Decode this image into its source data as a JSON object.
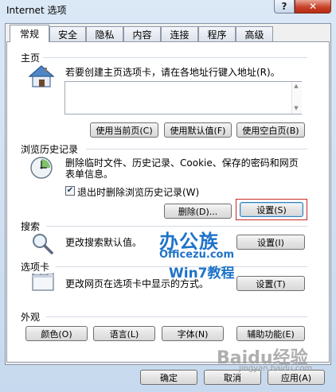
{
  "window": {
    "title": "Internet 选项",
    "help_glyph": "?",
    "close_glyph": "✕"
  },
  "tabs": [
    {
      "label": "常规",
      "active": true
    },
    {
      "label": "安全"
    },
    {
      "label": "隐私"
    },
    {
      "label": "内容"
    },
    {
      "label": "连接"
    },
    {
      "label": "程序"
    },
    {
      "label": "高级"
    }
  ],
  "home": {
    "section_label": "主页",
    "description": "若要创建主页选项卡，请在各地址行键入地址(R)。",
    "address_value": "",
    "buttons": {
      "use_current": "使用当前页(C)",
      "use_default": "使用默认值(F)",
      "use_blank": "使用空白页(B)"
    }
  },
  "history": {
    "section_label": "浏览历史记录",
    "description": "删除临时文件、历史记录、Cookie、保存的密码和网页表单信息。",
    "checkbox_label": "退出时删除浏览历史记录(W)",
    "checkbox_checked": true,
    "check_glyph": "✔",
    "buttons": {
      "delete": "删除(D)...",
      "settings": "设置(S)"
    }
  },
  "search": {
    "section_label": "搜索",
    "description": "更改搜索默认值。",
    "button": "设置(I)"
  },
  "tabs_section": {
    "section_label": "选项卡",
    "description": "更改网页在选项卡中显示的方式。",
    "button": "设置(T)"
  },
  "appearance": {
    "section_label": "外观",
    "buttons": {
      "colors": "颜色(O)",
      "languages": "语言(L)",
      "fonts": "字体(N)",
      "accessibility": "辅助功能(E)"
    }
  },
  "footer": {
    "ok": "确定",
    "cancel": "取消",
    "apply": "应用(A)"
  },
  "overlay": {
    "logo_line1": "办公族",
    "logo_line2": "Officezu.com",
    "logo_line3": "Win7教程",
    "watermark": "Baidu经验",
    "watermark_sub": "jingyan.baidu.com"
  },
  "colors": {
    "highlight_border": "#c82828",
    "logo_blue": "#1e73c8"
  }
}
